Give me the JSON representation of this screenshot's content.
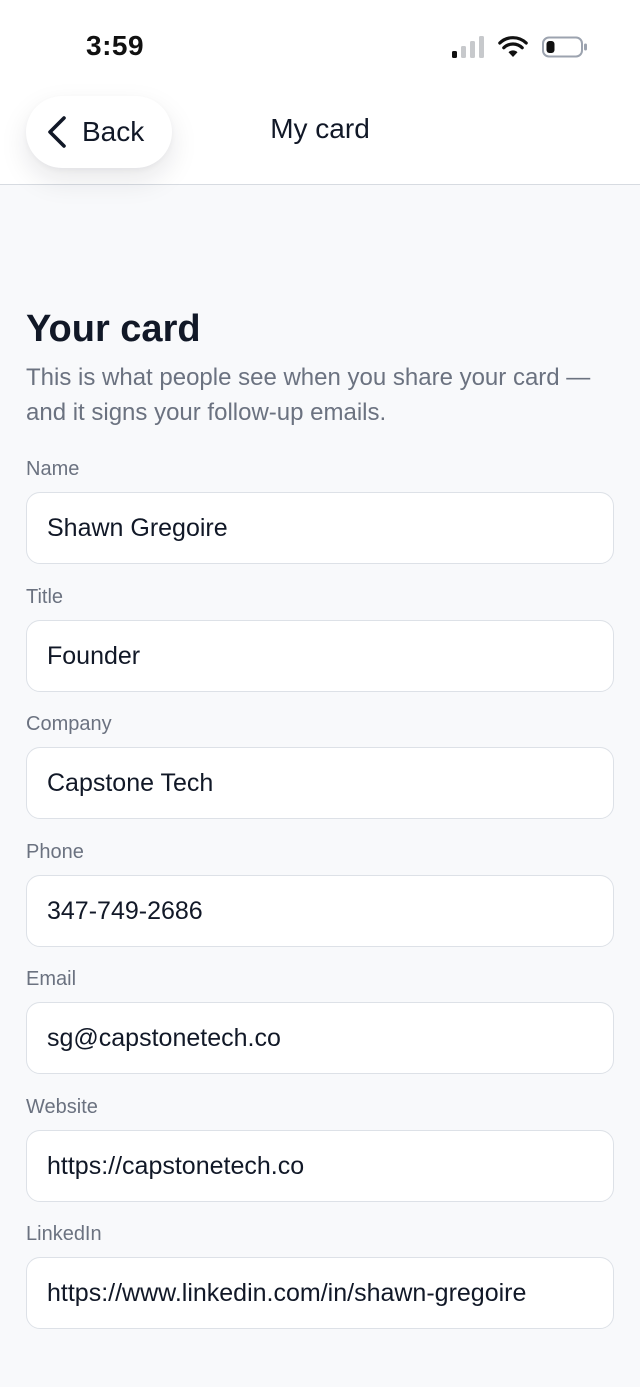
{
  "status_bar": {
    "time": "3:59"
  },
  "nav": {
    "back_label": "Back",
    "title": "My card"
  },
  "section": {
    "title": "Your card",
    "description": "This is what people see when you share your card — and it signs your follow-up emails."
  },
  "fields": [
    {
      "label": "Name",
      "value": "Shawn Gregoire"
    },
    {
      "label": "Title",
      "value": "Founder"
    },
    {
      "label": "Company",
      "value": "Capstone Tech"
    },
    {
      "label": "Phone",
      "value": "347-749-2686"
    },
    {
      "label": "Email",
      "value": "sg@capstonetech.co"
    },
    {
      "label": "Website",
      "value": "https://capstonetech.co"
    },
    {
      "label": "LinkedIn",
      "value": "https://www.linkedin.com/in/shawn-gregoire"
    }
  ],
  "colors": {
    "background": "#f8f9fb",
    "surface": "#ffffff",
    "text_primary": "#111827",
    "text_secondary": "#6b7280",
    "border": "#dde1e7"
  },
  "icons": {
    "back": "chevron-left-icon",
    "signal": "cellular-signal-icon",
    "wifi": "wifi-icon",
    "battery": "battery-icon"
  }
}
